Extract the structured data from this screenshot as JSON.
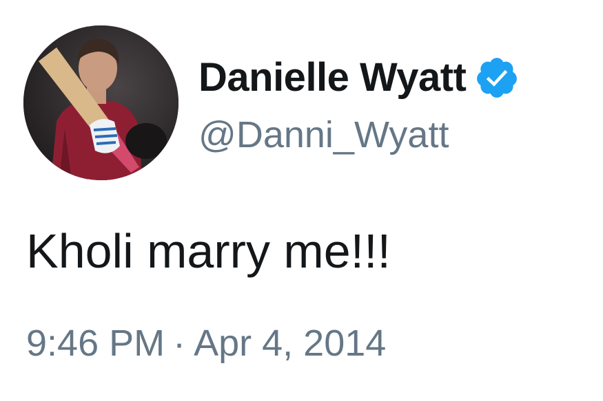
{
  "user": {
    "display_name": "Danielle Wyatt",
    "handle": "@Danni_Wyatt",
    "verified": true,
    "avatar_icon": "profile-photo-cricketer-with-bat",
    "verified_icon": "verified-badge-icon"
  },
  "tweet": {
    "text": "Kholi marry me!!!",
    "time": "9:46 PM",
    "separator": "·",
    "date": "Apr 4, 2014"
  },
  "colors": {
    "text_primary": "#14171a",
    "text_secondary": "#657786",
    "verified_blue": "#1da1f2",
    "background": "#ffffff"
  }
}
